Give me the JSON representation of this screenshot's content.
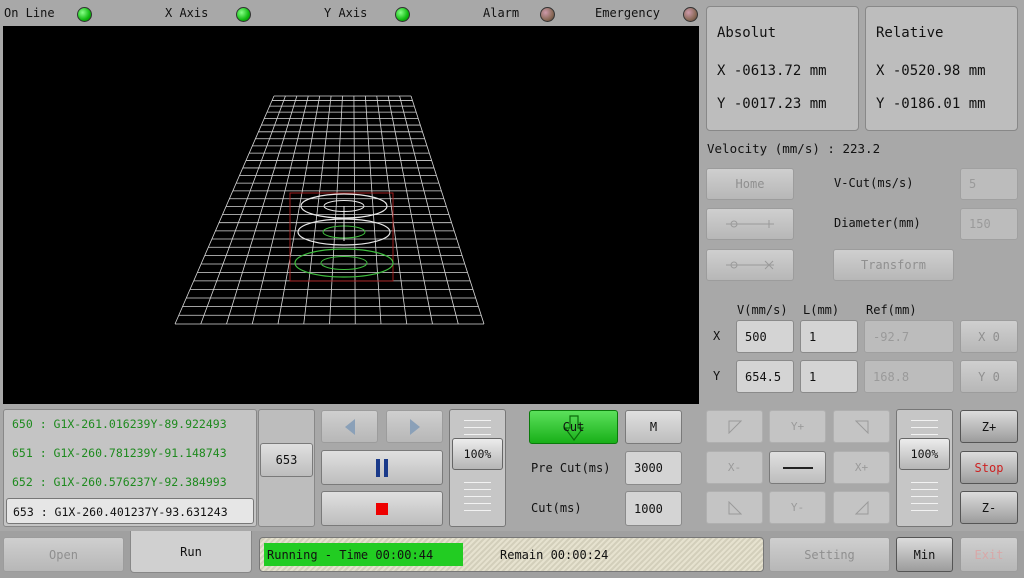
{
  "status": {
    "online": "On Line",
    "x_axis": "X Axis",
    "y_axis": "Y Axis",
    "alarm": "Alarm",
    "emergency": "Emergency"
  },
  "absolute": {
    "title": "Absolut",
    "x": "X -0613.72 mm",
    "y": "Y -0017.23 mm"
  },
  "relative": {
    "title": "Relative",
    "x": "X -0520.98 mm",
    "y": "Y -0186.01 mm"
  },
  "velocity": "Velocity (mm/s) : 223.2",
  "controls": {
    "home": "Home",
    "vcut_label": "V-Cut(ms/s)",
    "vcut_value": "5",
    "diameter_label": "Diameter(mm)",
    "diameter_value": "150",
    "transform": "Transform"
  },
  "axis_table": {
    "col_v": "V(mm/s)",
    "col_l": "L(mm)",
    "col_ref": "Ref(mm)",
    "x_label": "X",
    "x_v": "500",
    "x_l": "1",
    "x_ref": "-92.7",
    "x_zero": "X 0",
    "y_label": "Y",
    "y_v": "654.5",
    "y_l": "1",
    "y_ref": "168.8",
    "y_zero": "Y 0"
  },
  "gcode": [
    "650 : G1X-261.016239Y-89.922493",
    "651 : G1X-260.781239Y-91.148743",
    "652 : G1X-260.576237Y-92.384993",
    "653 : G1X-260.401237Y-93.631243"
  ],
  "line_counter": "653",
  "speed_override": "100%",
  "cut": {
    "cut_label": "Cut",
    "m_label": "M",
    "precut_label": "Pre Cut(ms)",
    "precut_value": "3000",
    "cutms_label": "Cut(ms)",
    "cutms_value": "1000"
  },
  "jog": {
    "yplus": "Y+",
    "xminus": "X-",
    "xplus": "X+",
    "yminus": "Y-",
    "jog_override": "100%",
    "zplus": "Z+",
    "stop": "Stop",
    "zminus": "Z-"
  },
  "footer": {
    "open": "Open",
    "run": "Run",
    "running_text": "Running  -  Time 00:00:44",
    "remain_text": "Remain 00:00:24",
    "setting": "Setting",
    "min": "Min",
    "exit": "Exit"
  },
  "colors": {
    "led_on": "#22bb22",
    "led_off": "#8a6a58",
    "cut_active": "#22cc22",
    "stop_red": "#cc2222",
    "gcode_green": "#1e8a1e"
  }
}
